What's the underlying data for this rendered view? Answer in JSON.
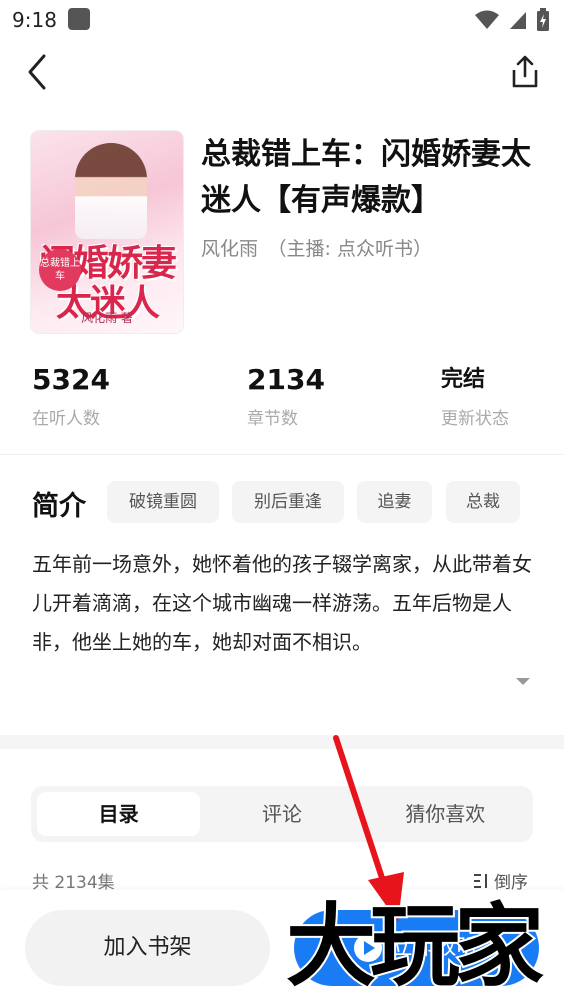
{
  "status_bar": {
    "time": "9:18"
  },
  "book": {
    "title": "总裁错上车：闪婚娇妻太迷人【有声爆款】",
    "author_line": "风化雨　（主播: 点众听书）",
    "cover": {
      "title": "闪婚娇妻太迷人",
      "badge": "总裁错上车",
      "author": "风化雨 著"
    }
  },
  "stats": [
    {
      "value": "5324",
      "label": "在听人数"
    },
    {
      "value": "2134",
      "label": "章节数"
    },
    {
      "value": "完结",
      "label": "更新状态"
    }
  ],
  "intro": {
    "heading": "简介",
    "tags": [
      "破镜重圆",
      "别后重逢",
      "追妻",
      "总裁"
    ],
    "text": "五年前一场意外，她怀着他的孩子辍学离家，从此带着女儿开着滴滴，在这个城市幽魂一样游荡。五年后物是人非，他坐上她的车，她却对面不相识。"
  },
  "tabs": [
    {
      "label": "目录",
      "active": true
    },
    {
      "label": "评论",
      "active": false
    },
    {
      "label": "猜你喜欢",
      "active": false
    }
  ],
  "catalog": {
    "episode_count": "共 2134集",
    "sort_label": "倒序"
  },
  "bottom": {
    "add_shelf": "加入书架",
    "listen_now": "立即收听"
  },
  "watermark": {
    "text": "大玩家"
  },
  "colors": {
    "accent": "#1a7cf5",
    "annotation_arrow": "#e8141c"
  },
  "icons": [
    "back-icon",
    "share-icon",
    "wifi-icon",
    "signal-icon",
    "battery-icon",
    "sort-icon",
    "play-icon",
    "expand-icon"
  ]
}
